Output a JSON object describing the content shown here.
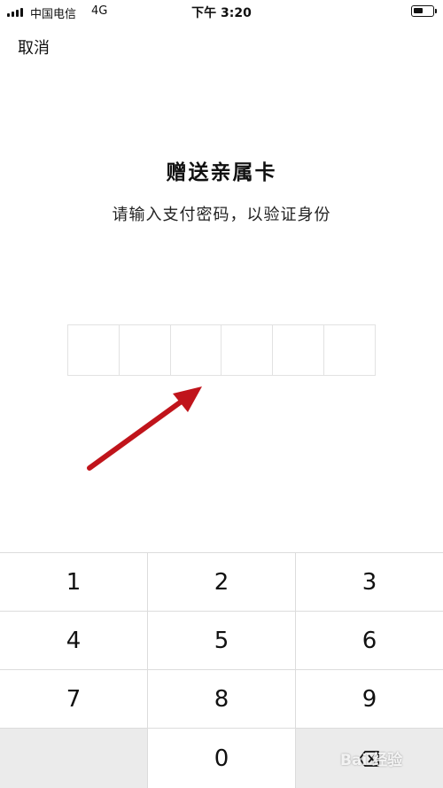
{
  "status_bar": {
    "carrier": "中国电信",
    "network": "4G",
    "time": "下午 3:20"
  },
  "header": {
    "cancel_label": "取消"
  },
  "main": {
    "title": "赠送亲属卡",
    "subtitle": "请输入支付密码，以验证身份",
    "pin_length": 6
  },
  "keypad": {
    "keys": [
      "1",
      "2",
      "3",
      "4",
      "5",
      "6",
      "7",
      "8",
      "9",
      "",
      "0",
      ""
    ]
  },
  "colors": {
    "arrow": "#c0141b",
    "keypad_gray": "#ebebeb",
    "divider": "#dcdcdc"
  },
  "icons": {
    "backspace": "backspace-icon",
    "signal": "signal-icon",
    "battery": "battery-icon"
  },
  "watermark": "Bai 经验"
}
